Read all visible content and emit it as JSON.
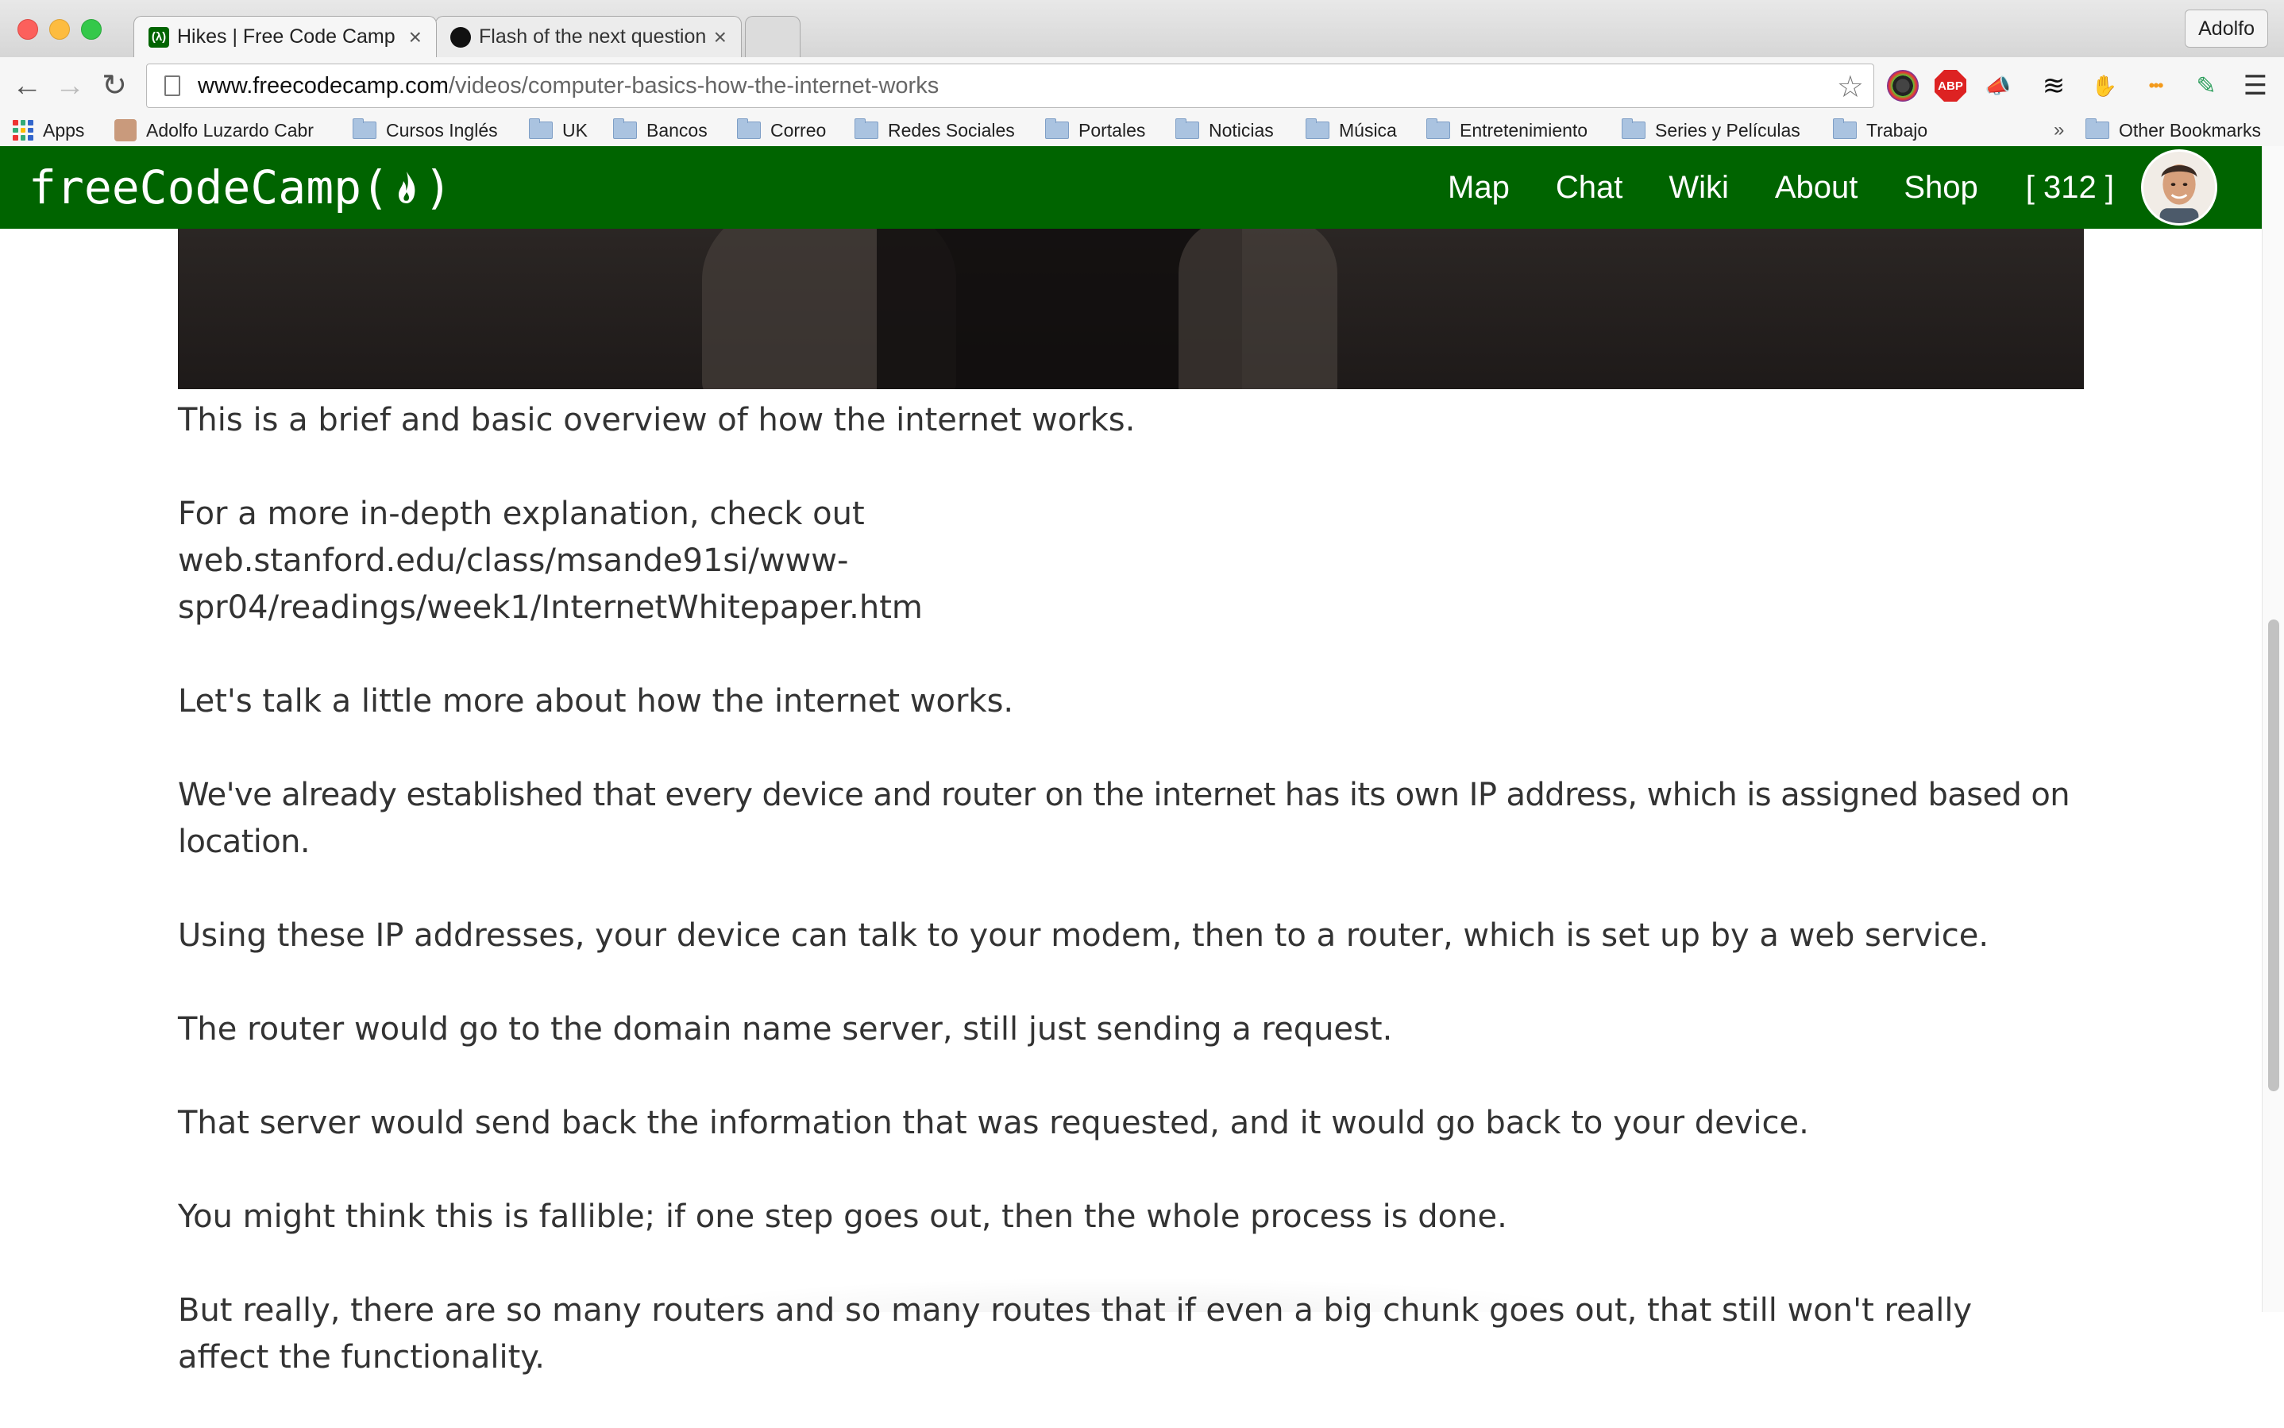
{
  "browser": {
    "tabs": [
      {
        "title": "Hikes | Free Code Camp",
        "close": "×"
      },
      {
        "title": "Flash of the next question a",
        "close": "×"
      }
    ],
    "profile_name": "Adolfo",
    "url": {
      "host": "www.freecodecamp.com",
      "path": "/videos/computer-basics-how-the-internet-works"
    },
    "bookmarks": {
      "apps": "Apps",
      "items": [
        "Adolfo Luzardo Cabr",
        "Cursos Inglés",
        "UK",
        "Bancos",
        "Correo",
        "Redes Sociales",
        "Portales",
        "Noticias",
        "Música",
        "Entretenimiento",
        "Series y Películas",
        "Trabajo"
      ],
      "overflow": "»",
      "other": "Other Bookmarks"
    }
  },
  "site": {
    "logo": {
      "before": "freeCodeCamp(",
      "after": ")"
    },
    "nav": [
      "Map",
      "Chat",
      "Wiki",
      "About",
      "Shop"
    ],
    "points": "[ 312 ]",
    "brand_color": "#006400"
  },
  "article": {
    "paragraphs": [
      "This is a brief and basic overview of how the internet works.",
      "For a more in-depth explanation, check out web.stanford.edu/class/msande91si/www-spr04/readings/week1/InternetWhitepaper.htm",
      "Let's talk a little more about how the internet works.",
      "We've already established that every device and router on the internet has its own IP address, which is assigned based on location.",
      "Using these IP addresses, your device can talk to your modem, then to a router, which is set up by a web service.",
      "The router would go to the domain name server, still just sending a request.",
      "That server would send back the information that was requested, and it would go back to your device.",
      "You might think this is fallible; if one step goes out, then the whole process is done.",
      "But really, there are so many routers and so many routes that if even a big chunk goes out, that still won't really affect the functionality."
    ]
  }
}
